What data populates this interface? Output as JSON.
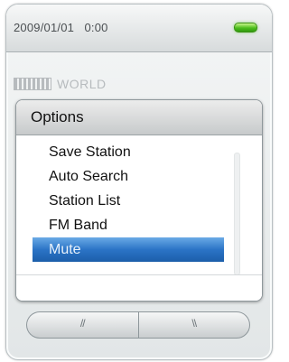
{
  "status_bar": {
    "datetime": "2009/01/01   0:00",
    "battery_color": "#4cbe1c"
  },
  "station": {
    "name": "WORLD"
  },
  "dialog": {
    "title": "Options",
    "items": [
      {
        "label": "Save Station",
        "selected": false
      },
      {
        "label": "Auto Search",
        "selected": false
      },
      {
        "label": "Station List",
        "selected": false
      },
      {
        "label": "FM Band",
        "selected": false
      },
      {
        "label": "Mute",
        "selected": true
      }
    ],
    "selection_color": "#2b74c6"
  },
  "softkeys": {
    "left_glyph": "//",
    "right_glyph": "\\\\"
  }
}
